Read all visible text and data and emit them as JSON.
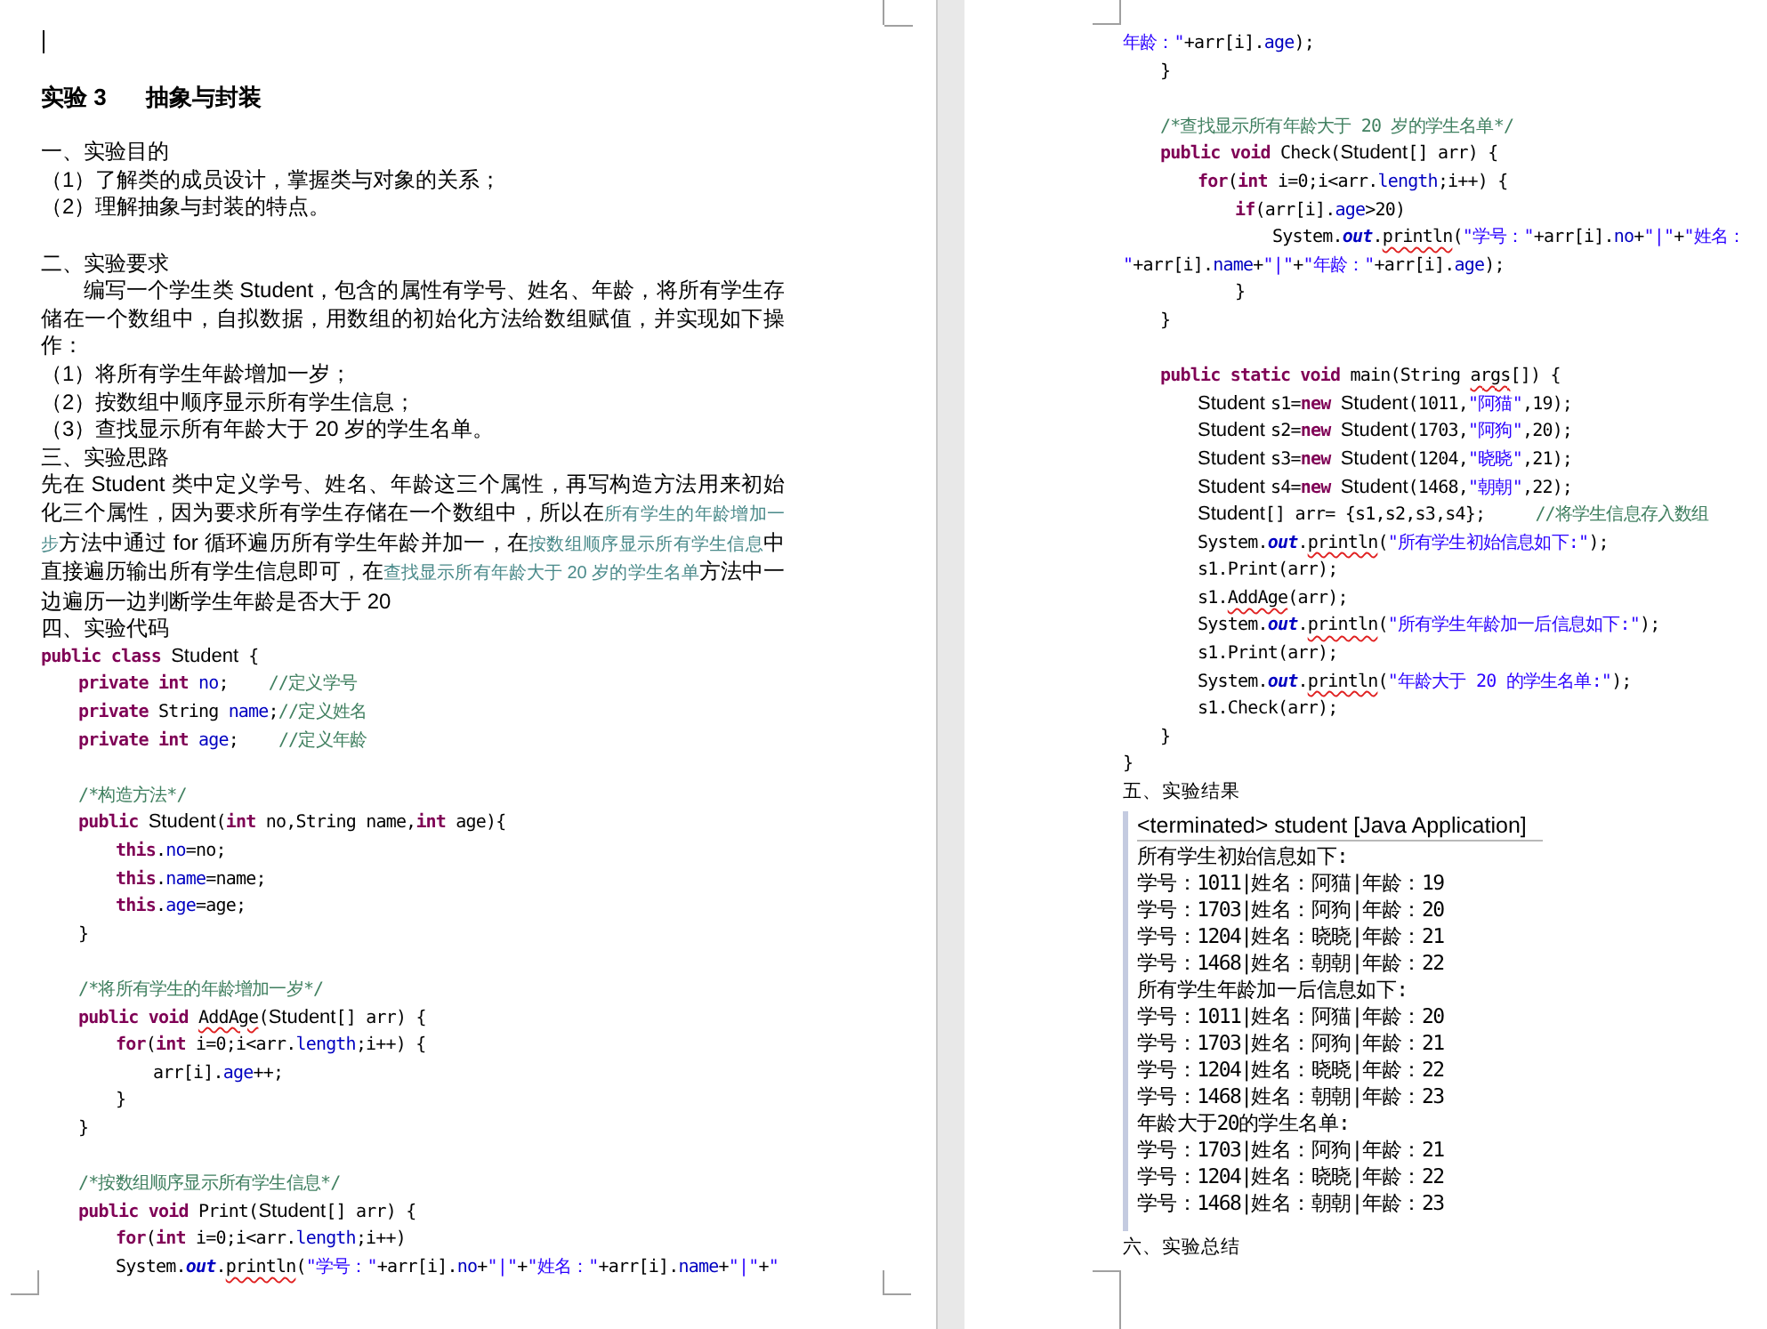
{
  "pages": [
    {
      "cursor": true,
      "blocks": [
        {
          "kind": "title",
          "label": "实验 3",
          "text": "抽象与封装"
        },
        {
          "kind": "blank"
        },
        {
          "kind": "heading",
          "text": "一、实验目的"
        },
        {
          "kind": "heading",
          "text": "（1）了解类的成员设计，掌握类与对象的关系；"
        },
        {
          "kind": "heading",
          "text": "（2）理解抽象与封装的特点。"
        },
        {
          "kind": "blank"
        },
        {
          "kind": "heading",
          "text": "二、实验要求"
        },
        {
          "kind": "para",
          "indent": true,
          "segments": [
            {
              "kind": "plain",
              "text": "编写一个学生类 Student，包含的属性有学号、姓名、年龄，将所有学生存储在一个数组中，自拟数据，用数组的初始化方法给数组赋值，并实现如下操作："
            }
          ]
        },
        {
          "kind": "heading",
          "text": "（1）将所有学生年龄增加一岁；"
        },
        {
          "kind": "heading",
          "text": "（2）按数组中顺序显示所有学生信息；"
        },
        {
          "kind": "heading",
          "text": "（3）查找显示所有年龄大于 20 岁的学生名单。"
        },
        {
          "kind": "heading",
          "text": "三、实验思路"
        },
        {
          "kind": "para",
          "indent": false,
          "segments": [
            {
              "kind": "plain",
              "text": "先在 Student 类中定义学号、姓名、年龄这三个属性，再写构造方法用来初始化三个属性，因为要求所有学生存储在一个数组中，所以在"
            },
            {
              "kind": "ref",
              "text": "所有学生的年龄增加一步"
            },
            {
              "kind": "plain",
              "text": "方法中通过 for 循环遍历所有学生年龄并加一，在"
            },
            {
              "kind": "ref",
              "text": "按数组顺序显示所有学生信息"
            },
            {
              "kind": "plain",
              "text": "中直接遍历输出所有学生信息即可，在"
            },
            {
              "kind": "ref",
              "text": "查找显示所有年龄大于 20 岁的学生名单"
            },
            {
              "kind": "plain",
              "text": "方法中一边遍历一边判断学生年龄是否大于 20"
            }
          ]
        },
        {
          "kind": "heading",
          "text": "四、实验代码"
        },
        {
          "kind": "code",
          "lines": [
            {
              "kind": "line",
              "segments": [
                {
                  "kind": "kw",
                  "text": "public class "
                },
                {
                  "kind": "class",
                  "text": "Student"
                },
                {
                  "kind": "plain",
                  "text": " {"
                }
              ],
              "children": [
                {
                  "kind": "line",
                  "segments": [
                    {
                      "kind": "kw",
                      "text": "private int "
                    },
                    {
                      "kind": "field",
                      "text": "no"
                    },
                    {
                      "kind": "plain",
                      "text": ";    "
                    },
                    {
                      "kind": "comment",
                      "text": "//定义学号"
                    }
                  ]
                },
                {
                  "kind": "line",
                  "segments": [
                    {
                      "kind": "kw",
                      "text": "private "
                    },
                    {
                      "kind": "plain",
                      "text": "String "
                    },
                    {
                      "kind": "field",
                      "text": "name"
                    },
                    {
                      "kind": "plain",
                      "text": ";"
                    },
                    {
                      "kind": "comment",
                      "text": "//定义姓名"
                    }
                  ]
                },
                {
                  "kind": "line",
                  "segments": [
                    {
                      "kind": "kw",
                      "text": "private int "
                    },
                    {
                      "kind": "field",
                      "text": "age"
                    },
                    {
                      "kind": "plain",
                      "text": ";    "
                    },
                    {
                      "kind": "comment",
                      "text": "//定义年龄"
                    }
                  ]
                },
                {
                  "kind": "blank"
                },
                {
                  "kind": "line",
                  "segments": [
                    {
                      "kind": "comment",
                      "text": "/*构造方法*/"
                    }
                  ]
                },
                {
                  "kind": "line",
                  "segments": [
                    {
                      "kind": "kw",
                      "text": "public "
                    },
                    {
                      "kind": "class",
                      "text": "Student"
                    },
                    {
                      "kind": "plain",
                      "text": "("
                    },
                    {
                      "kind": "kw",
                      "text": "int "
                    },
                    {
                      "kind": "plain",
                      "text": "no,String name,"
                    },
                    {
                      "kind": "kw",
                      "text": "int "
                    },
                    {
                      "kind": "plain",
                      "text": "age){"
                    }
                  ],
                  "children": [
                    {
                      "kind": "line",
                      "segments": [
                        {
                          "kind": "kw",
                          "text": "this"
                        },
                        {
                          "kind": "plain",
                          "text": "."
                        },
                        {
                          "kind": "field",
                          "text": "no"
                        },
                        {
                          "kind": "plain",
                          "text": "=no;"
                        }
                      ]
                    },
                    {
                      "kind": "line",
                      "segments": [
                        {
                          "kind": "kw",
                          "text": "this"
                        },
                        {
                          "kind": "plain",
                          "text": "."
                        },
                        {
                          "kind": "field",
                          "text": "name"
                        },
                        {
                          "kind": "plain",
                          "text": "=name;"
                        }
                      ]
                    },
                    {
                      "kind": "line",
                      "segments": [
                        {
                          "kind": "kw",
                          "text": "this"
                        },
                        {
                          "kind": "plain",
                          "text": "."
                        },
                        {
                          "kind": "field",
                          "text": "age"
                        },
                        {
                          "kind": "plain",
                          "text": "=age;"
                        }
                      ]
                    }
                  ]
                },
                {
                  "kind": "line",
                  "segments": [
                    {
                      "kind": "plain",
                      "text": "}"
                    }
                  ]
                },
                {
                  "kind": "blank"
                },
                {
                  "kind": "line",
                  "segments": [
                    {
                      "kind": "comment",
                      "text": "/*将所有学生的年龄增加一岁*/"
                    }
                  ]
                },
                {
                  "kind": "line",
                  "segments": [
                    {
                      "kind": "kw",
                      "text": "public void "
                    },
                    {
                      "kind": "misspelled",
                      "text": "AddAge"
                    },
                    {
                      "kind": "plain",
                      "text": "("
                    },
                    {
                      "kind": "class",
                      "text": "Student"
                    },
                    {
                      "kind": "plain",
                      "text": "[] arr) {"
                    }
                  ],
                  "children": [
                    {
                      "kind": "line",
                      "segments": [
                        {
                          "kind": "kw",
                          "text": "for"
                        },
                        {
                          "kind": "plain",
                          "text": "("
                        },
                        {
                          "kind": "kw",
                          "text": "int "
                        },
                        {
                          "kind": "plain",
                          "text": "i=0;i<arr."
                        },
                        {
                          "kind": "field",
                          "text": "length"
                        },
                        {
                          "kind": "plain",
                          "text": ";i++) {"
                        }
                      ],
                      "children": [
                        {
                          "kind": "line",
                          "segments": [
                            {
                              "kind": "plain",
                              "text": "arr[i]."
                            },
                            {
                              "kind": "field",
                              "text": "age"
                            },
                            {
                              "kind": "plain",
                              "text": "++;"
                            }
                          ]
                        }
                      ]
                    },
                    {
                      "kind": "line",
                      "segments": [
                        {
                          "kind": "plain",
                          "text": "}"
                        }
                      ]
                    }
                  ]
                },
                {
                  "kind": "line",
                  "segments": [
                    {
                      "kind": "plain",
                      "text": "}"
                    }
                  ]
                },
                {
                  "kind": "blank"
                },
                {
                  "kind": "line",
                  "segments": [
                    {
                      "kind": "comment",
                      "text": "/*按数组顺序显示所有学生信息*/"
                    }
                  ]
                },
                {
                  "kind": "line",
                  "segments": [
                    {
                      "kind": "kw",
                      "text": "public void "
                    },
                    {
                      "kind": "plain",
                      "text": "Print("
                    },
                    {
                      "kind": "class",
                      "text": "Student"
                    },
                    {
                      "kind": "plain",
                      "text": "[] arr) {"
                    }
                  ],
                  "children": [
                    {
                      "kind": "line",
                      "segments": [
                        {
                          "kind": "kw",
                          "text": "for"
                        },
                        {
                          "kind": "plain",
                          "text": "("
                        },
                        {
                          "kind": "kw",
                          "text": "int "
                        },
                        {
                          "kind": "plain",
                          "text": "i=0;i<arr."
                        },
                        {
                          "kind": "field",
                          "text": "length"
                        },
                        {
                          "kind": "plain",
                          "text": ";i++)"
                        }
                      ]
                    },
                    {
                      "kind": "line",
                      "segments": [
                        {
                          "kind": "plain",
                          "text": "System."
                        },
                        {
                          "kind": "static",
                          "text": "out"
                        },
                        {
                          "kind": "plain",
                          "text": "."
                        },
                        {
                          "kind": "misspelled",
                          "text": "println"
                        },
                        {
                          "kind": "plain",
                          "text": "("
                        },
                        {
                          "kind": "string",
                          "text": "\"学号：\""
                        },
                        {
                          "kind": "plain",
                          "text": "+arr[i]."
                        },
                        {
                          "kind": "field",
                          "text": "no"
                        },
                        {
                          "kind": "plain",
                          "text": "+"
                        },
                        {
                          "kind": "string",
                          "text": "\"|\""
                        },
                        {
                          "kind": "plain",
                          "text": "+"
                        },
                        {
                          "kind": "string",
                          "text": "\"姓名：\""
                        },
                        {
                          "kind": "plain",
                          "text": "+arr[i]."
                        },
                        {
                          "kind": "field",
                          "text": "name"
                        },
                        {
                          "kind": "plain",
                          "text": "+"
                        },
                        {
                          "kind": "string",
                          "text": "\"|\""
                        },
                        {
                          "kind": "plain",
                          "text": "+"
                        },
                        {
                          "kind": "string",
                          "text": "\""
                        }
                      ]
                    }
                  ]
                }
              ]
            }
          ]
        }
      ]
    },
    {
      "cursor": false,
      "blocks": [
        {
          "kind": "code",
          "lines": [
            {
              "kind": "line",
              "segments": [
                {
                  "kind": "string",
                  "text": "年龄：\""
                },
                {
                  "kind": "plain",
                  "text": "+arr[i]."
                },
                {
                  "kind": "field",
                  "text": "age"
                },
                {
                  "kind": "plain",
                  "text": ");"
                }
              ]
            },
            {
              "kind": "group",
              "children": [
                {
                  "kind": "line",
                  "segments": [
                    {
                      "kind": "plain",
                      "text": "}"
                    }
                  ]
                },
                {
                  "kind": "blank"
                },
                {
                  "kind": "line",
                  "segments": [
                    {
                      "kind": "comment",
                      "text": "/*查找显示所有年龄大于 20 岁的学生名单*/"
                    }
                  ]
                },
                {
                  "kind": "line",
                  "segments": [
                    {
                      "kind": "kw",
                      "text": "public void "
                    },
                    {
                      "kind": "plain",
                      "text": "Check("
                    },
                    {
                      "kind": "class",
                      "text": "Student"
                    },
                    {
                      "kind": "plain",
                      "text": "[] arr) {"
                    }
                  ],
                  "children": [
                    {
                      "kind": "line",
                      "segments": [
                        {
                          "kind": "kw",
                          "text": "for"
                        },
                        {
                          "kind": "plain",
                          "text": "("
                        },
                        {
                          "kind": "kw",
                          "text": "int "
                        },
                        {
                          "kind": "plain",
                          "text": "i=0;i<arr."
                        },
                        {
                          "kind": "field",
                          "text": "length"
                        },
                        {
                          "kind": "plain",
                          "text": ";i++) {"
                        }
                      ],
                      "children": [
                        {
                          "kind": "line",
                          "segments": [
                            {
                              "kind": "kw",
                              "text": "if"
                            },
                            {
                              "kind": "plain",
                              "text": "(arr[i]."
                            },
                            {
                              "kind": "field",
                              "text": "age"
                            },
                            {
                              "kind": "plain",
                              "text": ">20)"
                            }
                          ],
                          "children": [
                            {
                              "kind": "line",
                              "segments": [
                                {
                                  "kind": "plain",
                                  "text": "System."
                                },
                                {
                                  "kind": "static",
                                  "text": "out"
                                },
                                {
                                  "kind": "plain",
                                  "text": "."
                                },
                                {
                                  "kind": "misspelled",
                                  "text": "println"
                                },
                                {
                                  "kind": "plain",
                                  "text": "("
                                },
                                {
                                  "kind": "string",
                                  "text": "\"学号：\""
                                },
                                {
                                  "kind": "plain",
                                  "text": "+arr[i]."
                                },
                                {
                                  "kind": "field",
                                  "text": "no"
                                },
                                {
                                  "kind": "plain",
                                  "text": "+"
                                },
                                {
                                  "kind": "string",
                                  "text": "\"|\""
                                },
                                {
                                  "kind": "plain",
                                  "text": "+"
                                },
                                {
                                  "kind": "string",
                                  "text": "\"姓名："
                                }
                              ],
                              "continuation": [
                                {
                                  "kind": "string",
                                  "text": "\""
                                },
                                {
                                  "kind": "plain",
                                  "text": "+arr[i]."
                                },
                                {
                                  "kind": "field",
                                  "text": "name"
                                },
                                {
                                  "kind": "plain",
                                  "text": "+"
                                },
                                {
                                  "kind": "string",
                                  "text": "\"|\""
                                },
                                {
                                  "kind": "plain",
                                  "text": "+"
                                },
                                {
                                  "kind": "string",
                                  "text": "\"年龄：\""
                                },
                                {
                                  "kind": "plain",
                                  "text": "+arr[i]."
                                },
                                {
                                  "kind": "field",
                                  "text": "age"
                                },
                                {
                                  "kind": "plain",
                                  "text": ");"
                                }
                              ]
                            }
                          ]
                        },
                        {
                          "kind": "line",
                          "segments": [
                            {
                              "kind": "plain",
                              "text": "}"
                            }
                          ]
                        }
                      ]
                    }
                  ]
                },
                {
                  "kind": "line",
                  "segments": [
                    {
                      "kind": "plain",
                      "text": "}"
                    }
                  ]
                },
                {
                  "kind": "blank"
                },
                {
                  "kind": "line",
                  "segments": [
                    {
                      "kind": "kw",
                      "text": "public static void "
                    },
                    {
                      "kind": "plain",
                      "text": "main(String "
                    },
                    {
                      "kind": "misspelled",
                      "text": "args"
                    },
                    {
                      "kind": "plain",
                      "text": "[]) {"
                    }
                  ],
                  "children": [
                    {
                      "kind": "line",
                      "segments": [
                        {
                          "kind": "class",
                          "text": "Student "
                        },
                        {
                          "kind": "plain",
                          "text": "s1="
                        },
                        {
                          "kind": "kw",
                          "text": "new "
                        },
                        {
                          "kind": "class",
                          "text": "Student"
                        },
                        {
                          "kind": "plain",
                          "text": "(1011,"
                        },
                        {
                          "kind": "string",
                          "text": "\"阿猫\""
                        },
                        {
                          "kind": "plain",
                          "text": ",19);"
                        }
                      ]
                    },
                    {
                      "kind": "line",
                      "segments": [
                        {
                          "kind": "class",
                          "text": "Student "
                        },
                        {
                          "kind": "plain",
                          "text": "s2="
                        },
                        {
                          "kind": "kw",
                          "text": "new "
                        },
                        {
                          "kind": "class",
                          "text": "Student"
                        },
                        {
                          "kind": "plain",
                          "text": "(1703,"
                        },
                        {
                          "kind": "string",
                          "text": "\"阿狗\""
                        },
                        {
                          "kind": "plain",
                          "text": ",20);"
                        }
                      ]
                    },
                    {
                      "kind": "line",
                      "segments": [
                        {
                          "kind": "class",
                          "text": "Student "
                        },
                        {
                          "kind": "plain",
                          "text": "s3="
                        },
                        {
                          "kind": "kw",
                          "text": "new "
                        },
                        {
                          "kind": "class",
                          "text": "Student"
                        },
                        {
                          "kind": "plain",
                          "text": "(1204,"
                        },
                        {
                          "kind": "string",
                          "text": "\"晓晓\""
                        },
                        {
                          "kind": "plain",
                          "text": ",21);"
                        }
                      ]
                    },
                    {
                      "kind": "line",
                      "segments": [
                        {
                          "kind": "class",
                          "text": "Student "
                        },
                        {
                          "kind": "plain",
                          "text": "s4="
                        },
                        {
                          "kind": "kw",
                          "text": "new "
                        },
                        {
                          "kind": "class",
                          "text": "Student"
                        },
                        {
                          "kind": "plain",
                          "text": "(1468,"
                        },
                        {
                          "kind": "string",
                          "text": "\"朝朝\""
                        },
                        {
                          "kind": "plain",
                          "text": ",22);"
                        }
                      ]
                    },
                    {
                      "kind": "line",
                      "segments": [
                        {
                          "kind": "class",
                          "text": "Student"
                        },
                        {
                          "kind": "plain",
                          "text": "[] arr= {s1,s2,s3,s4};     "
                        },
                        {
                          "kind": "comment",
                          "text": "//将学生信息存入数组"
                        }
                      ]
                    },
                    {
                      "kind": "line",
                      "segments": [
                        {
                          "kind": "plain",
                          "text": "System."
                        },
                        {
                          "kind": "static",
                          "text": "out"
                        },
                        {
                          "kind": "plain",
                          "text": "."
                        },
                        {
                          "kind": "misspelled",
                          "text": "println"
                        },
                        {
                          "kind": "plain",
                          "text": "("
                        },
                        {
                          "kind": "string",
                          "text": "\"所有学生初始信息如下:\""
                        },
                        {
                          "kind": "plain",
                          "text": ");"
                        }
                      ]
                    },
                    {
                      "kind": "line",
                      "segments": [
                        {
                          "kind": "plain",
                          "text": "s1.Print(arr);"
                        }
                      ]
                    },
                    {
                      "kind": "line",
                      "segments": [
                        {
                          "kind": "plain",
                          "text": "s1."
                        },
                        {
                          "kind": "misspelled",
                          "text": "AddAge"
                        },
                        {
                          "kind": "plain",
                          "text": "(arr);"
                        }
                      ]
                    },
                    {
                      "kind": "line",
                      "segments": [
                        {
                          "kind": "plain",
                          "text": "System."
                        },
                        {
                          "kind": "static",
                          "text": "out"
                        },
                        {
                          "kind": "plain",
                          "text": "."
                        },
                        {
                          "kind": "misspelled",
                          "text": "println"
                        },
                        {
                          "kind": "plain",
                          "text": "("
                        },
                        {
                          "kind": "string",
                          "text": "\"所有学生年龄加一后信息如下:\""
                        },
                        {
                          "kind": "plain",
                          "text": ");"
                        }
                      ]
                    },
                    {
                      "kind": "line",
                      "segments": [
                        {
                          "kind": "plain",
                          "text": "s1.Print(arr);"
                        }
                      ]
                    },
                    {
                      "kind": "line",
                      "segments": [
                        {
                          "kind": "plain",
                          "text": "System."
                        },
                        {
                          "kind": "static",
                          "text": "out"
                        },
                        {
                          "kind": "plain",
                          "text": "."
                        },
                        {
                          "kind": "misspelled",
                          "text": "println"
                        },
                        {
                          "kind": "plain",
                          "text": "("
                        },
                        {
                          "kind": "string",
                          "text": "\"年龄大于 20 的学生名单:\""
                        },
                        {
                          "kind": "plain",
                          "text": ");"
                        }
                      ]
                    },
                    {
                      "kind": "line",
                      "segments": [
                        {
                          "kind": "plain",
                          "text": "s1.Check(arr);"
                        }
                      ]
                    }
                  ]
                },
                {
                  "kind": "line",
                  "segments": [
                    {
                      "kind": "plain",
                      "text": "}"
                    }
                  ]
                }
              ]
            },
            {
              "kind": "line",
              "segments": [
                {
                  "kind": "plain",
                  "text": "}"
                }
              ]
            }
          ]
        },
        {
          "kind": "caption",
          "text": "五、实验结果"
        },
        {
          "kind": "console",
          "header": "<terminated> student [Java Application]",
          "lines": [
            "所有学生初始信息如下:",
            "学号：1011|姓名：阿猫|年龄：19",
            "学号：1703|姓名：阿狗|年龄：20",
            "学号：1204|姓名：晓晓|年龄：21",
            "学号：1468|姓名：朝朝|年龄：22",
            "所有学生年龄加一后信息如下:",
            "学号：1011|姓名：阿猫|年龄：20",
            "学号：1703|姓名：阿狗|年龄：21",
            "学号：1204|姓名：晓晓|年龄：22",
            "学号：1468|姓名：朝朝|年龄：23",
            "年龄大于20的学生名单:",
            "学号：1703|姓名：阿狗|年龄：21",
            "学号：1204|姓名：晓晓|年龄：22",
            "学号：1468|姓名：朝朝|年龄：23"
          ]
        },
        {
          "kind": "caption",
          "text": "六、实验总结"
        }
      ]
    }
  ]
}
